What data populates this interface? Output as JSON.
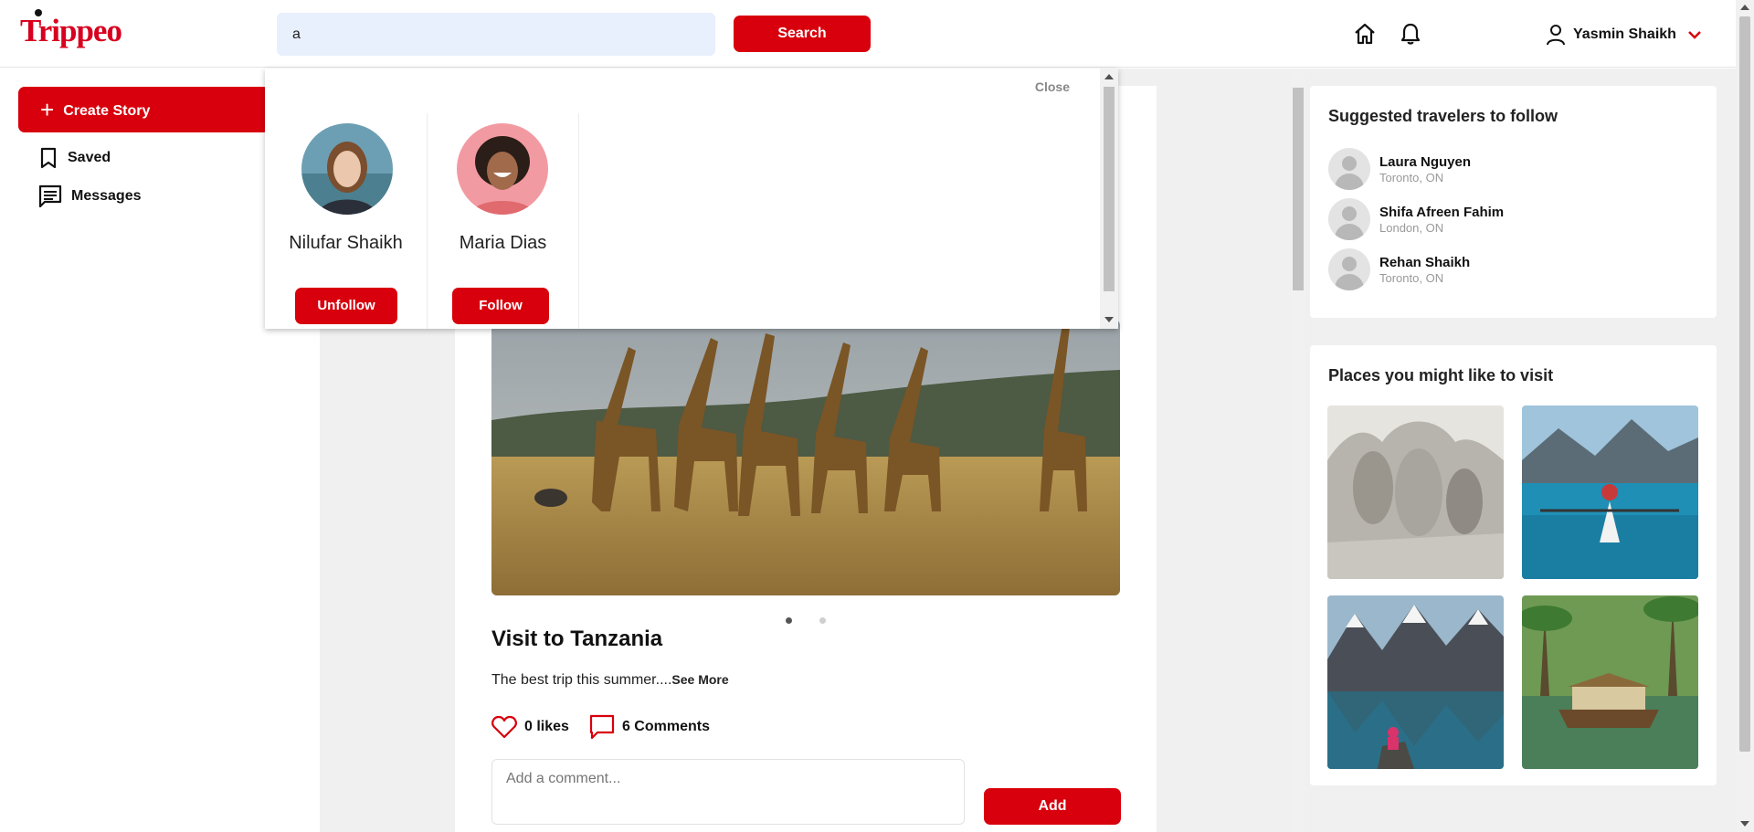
{
  "header": {
    "logo_text": "Trippeo",
    "search_value": "a",
    "search_button": "Search",
    "user_name": "Yasmin Shaikh"
  },
  "sidebar": {
    "create_story": "Create Story",
    "items": [
      {
        "label": "Saved",
        "icon": "bookmark-icon"
      },
      {
        "label": "Messages",
        "icon": "message-icon"
      }
    ]
  },
  "search_dropdown": {
    "close_label": "Close",
    "results": [
      {
        "name": "Nilufar Shaikh",
        "action": "Unfollow"
      },
      {
        "name": "Maria Dias",
        "action": "Follow"
      }
    ]
  },
  "post": {
    "title": "Visit to Tanzania",
    "description": "The best trip this summer....",
    "see_more": "See More",
    "likes": "0 likes",
    "comments": "6 Comments",
    "comment_placeholder": "Add a comment...",
    "add_button": "Add",
    "carousel_total": 2,
    "carousel_active": 1
  },
  "suggested": {
    "title": "Suggested travelers to follow",
    "travelers": [
      {
        "name": "Laura Nguyen",
        "location": "Toronto, ON"
      },
      {
        "name": "Shifa Afreen Fahim",
        "location": "London, ON"
      },
      {
        "name": "Rehan Shaikh",
        "location": "Toronto, ON"
      }
    ]
  },
  "places": {
    "title": "Places you might like to visit"
  },
  "colors": {
    "accent": "#d8000c",
    "search_bg": "#e8effd",
    "page_bg": "#f0f0f0"
  }
}
